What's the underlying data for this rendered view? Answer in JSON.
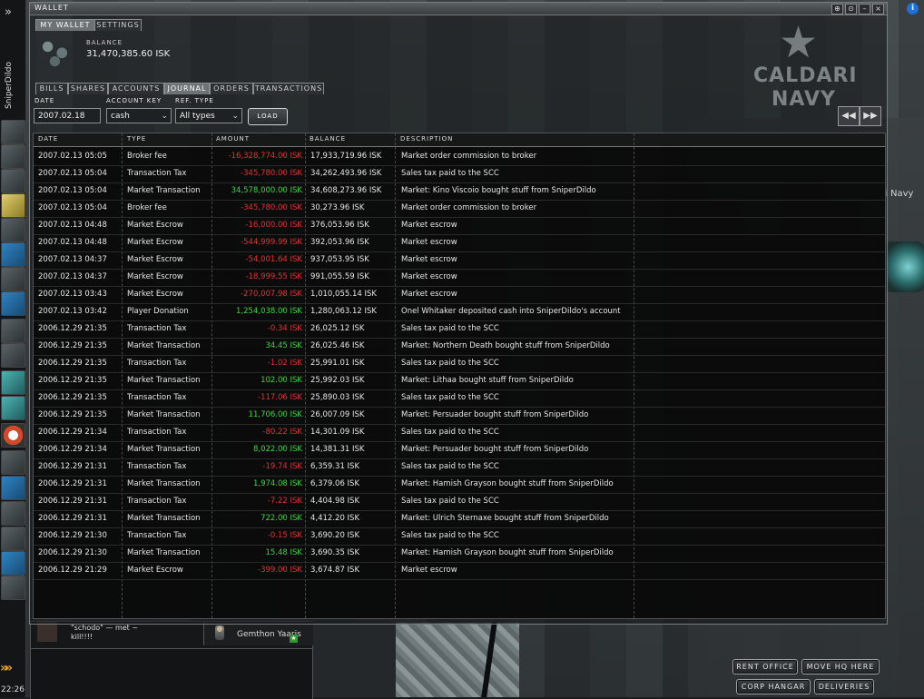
{
  "window": {
    "title": "WALLET",
    "controls": [
      "⊕",
      "⊙",
      "–",
      "×"
    ]
  },
  "tabs_top": [
    "MY WALLET",
    "SETTINGS"
  ],
  "balance": {
    "label": "BALANCE",
    "value": "31,470,385.60 ISK"
  },
  "tabs_sub": [
    "BILLS",
    "SHARES",
    "ACCOUNTS",
    "JOURNAL",
    "ORDERS",
    "TRANSACTIONS"
  ],
  "filters": {
    "date_label": "DATE",
    "account_label": "ACCOUNT KEY",
    "type_label": "REF. TYPE",
    "date_value": "2007.02.18",
    "account_value": "cash",
    "type_value": "All types",
    "load_label": "LOAD"
  },
  "table": {
    "headers": [
      "DATE",
      "TYPE",
      "AMOUNT",
      "BALANCE",
      "DESCRIPTION"
    ],
    "rows": [
      {
        "date": "2007.02.13 05:05",
        "type": "Broker fee",
        "amount": "-16,328,774.00 ISK",
        "sign": "neg",
        "balance": "17,933,719.96 ISK",
        "desc": "Market order commission to broker"
      },
      {
        "date": "2007.02.13 05:04",
        "type": "Transaction Tax",
        "amount": "-345,780.00 ISK",
        "sign": "neg",
        "balance": "34,262,493.96 ISK",
        "desc": "Sales tax paid to the SCC"
      },
      {
        "date": "2007.02.13 05:04",
        "type": "Market Transaction",
        "amount": "34,578,000.00 ISK",
        "sign": "pos",
        "balance": "34,608,273.96 ISK",
        "desc": "Market: Kino Viscoio bought stuff from SniperDildo"
      },
      {
        "date": "2007.02.13 05:04",
        "type": "Broker fee",
        "amount": "-345,780.00 ISK",
        "sign": "neg",
        "balance": "30,273.96 ISK",
        "desc": "Market order commission to broker"
      },
      {
        "date": "2007.02.13 04:48",
        "type": "Market Escrow",
        "amount": "-16,000.00 ISK",
        "sign": "neg",
        "balance": "376,053.96 ISK",
        "desc": "Market escrow"
      },
      {
        "date": "2007.02.13 04:48",
        "type": "Market Escrow",
        "amount": "-544,999.99 ISK",
        "sign": "neg",
        "balance": "392,053.96 ISK",
        "desc": "Market escrow"
      },
      {
        "date": "2007.02.13 04:37",
        "type": "Market Escrow",
        "amount": "-54,001.64 ISK",
        "sign": "neg",
        "balance": "937,053.95 ISK",
        "desc": "Market escrow"
      },
      {
        "date": "2007.02.13 04:37",
        "type": "Market Escrow",
        "amount": "-18,999.55 ISK",
        "sign": "neg",
        "balance": "991,055.59 ISK",
        "desc": "Market escrow"
      },
      {
        "date": "2007.02.13 03:43",
        "type": "Market Escrow",
        "amount": "-270,007.98 ISK",
        "sign": "neg",
        "balance": "1,010,055.14 ISK",
        "desc": "Market escrow"
      },
      {
        "date": "2007.02.13 03:42",
        "type": "Player Donation",
        "amount": "1,254,038.00 ISK",
        "sign": "pos",
        "balance": "1,280,063.12 ISK",
        "desc": "Onel Whitaker deposited cash into SniperDildo's account"
      },
      {
        "date": "2006.12.29 21:35",
        "type": "Transaction Tax",
        "amount": "-0.34 ISK",
        "sign": "neg",
        "balance": "26,025.12 ISK",
        "desc": "Sales tax paid to the SCC"
      },
      {
        "date": "2006.12.29 21:35",
        "type": "Market Transaction",
        "amount": "34.45 ISK",
        "sign": "pos",
        "balance": "26,025.46 ISK",
        "desc": "Market: Northern Death bought stuff from SniperDildo"
      },
      {
        "date": "2006.12.29 21:35",
        "type": "Transaction Tax",
        "amount": "-1.02 ISK",
        "sign": "neg",
        "balance": "25,991.01 ISK",
        "desc": "Sales tax paid to the SCC"
      },
      {
        "date": "2006.12.29 21:35",
        "type": "Market Transaction",
        "amount": "102.00 ISK",
        "sign": "pos",
        "balance": "25,992.03 ISK",
        "desc": "Market: Lithaa bought stuff from SniperDildo"
      },
      {
        "date": "2006.12.29 21:35",
        "type": "Transaction Tax",
        "amount": "-117.06 ISK",
        "sign": "neg",
        "balance": "25,890.03 ISK",
        "desc": "Sales tax paid to the SCC"
      },
      {
        "date": "2006.12.29 21:35",
        "type": "Market Transaction",
        "amount": "11,706.00 ISK",
        "sign": "pos",
        "balance": "26,007.09 ISK",
        "desc": "Market: Persuader bought stuff from SniperDildo"
      },
      {
        "date": "2006.12.29 21:34",
        "type": "Transaction Tax",
        "amount": "-80.22 ISK",
        "sign": "neg",
        "balance": "14,301.09 ISK",
        "desc": "Sales tax paid to the SCC"
      },
      {
        "date": "2006.12.29 21:34",
        "type": "Market Transaction",
        "amount": "8,022.00 ISK",
        "sign": "pos",
        "balance": "14,381.31 ISK",
        "desc": "Market: Persuader bought stuff from SniperDildo"
      },
      {
        "date": "2006.12.29 21:31",
        "type": "Transaction Tax",
        "amount": "-19.74 ISK",
        "sign": "neg",
        "balance": "6,359.31 ISK",
        "desc": "Sales tax paid to the SCC"
      },
      {
        "date": "2006.12.29 21:31",
        "type": "Market Transaction",
        "amount": "1,974.08 ISK",
        "sign": "pos",
        "balance": "6,379.06 ISK",
        "desc": "Market: Hamish Grayson bought stuff from SniperDildo"
      },
      {
        "date": "2006.12.29 21:31",
        "type": "Transaction Tax",
        "amount": "-7.22 ISK",
        "sign": "neg",
        "balance": "4,404.98 ISK",
        "desc": "Sales tax paid to the SCC"
      },
      {
        "date": "2006.12.29 21:31",
        "type": "Market Transaction",
        "amount": "722.00 ISK",
        "sign": "pos",
        "balance": "4,412.20 ISK",
        "desc": "Market: Ulrich Sternaxe bought stuff from SniperDildo"
      },
      {
        "date": "2006.12.29 21:30",
        "type": "Transaction Tax",
        "amount": "-0.15 ISK",
        "sign": "neg",
        "balance": "3,690.20 ISK",
        "desc": "Sales tax paid to the SCC"
      },
      {
        "date": "2006.12.29 21:30",
        "type": "Market Transaction",
        "amount": "15.48 ISK",
        "sign": "pos",
        "balance": "3,690.35 ISK",
        "desc": "Market: Hamish Grayson bought stuff from SniperDildo"
      },
      {
        "date": "2006.12.29 21:29",
        "type": "Market Escrow",
        "amount": "-399.00 ISK",
        "sign": "neg",
        "balance": "3,674.87 ISK",
        "desc": "Market escrow"
      }
    ]
  },
  "emblem": {
    "line1": "CALDARI",
    "line2": "NAVY",
    "side": "i Navy"
  },
  "neocom": {
    "character": "SniperDildo",
    "clock": "22:26",
    "expand": "»",
    "more": "»»"
  },
  "station_buttons": [
    "RENT OFFICE",
    "MOVE HQ HERE",
    "CORP HANGAR",
    "DELIVERIES"
  ],
  "chat": {
    "message": "\"schodo\" — met ~\nkill!!!!",
    "member": "Gemthon Yaaris",
    "member_badge": "★"
  },
  "colors": {
    "negative": "#e03434",
    "positive": "#3ed43e",
    "info": "#1e6fd6"
  }
}
